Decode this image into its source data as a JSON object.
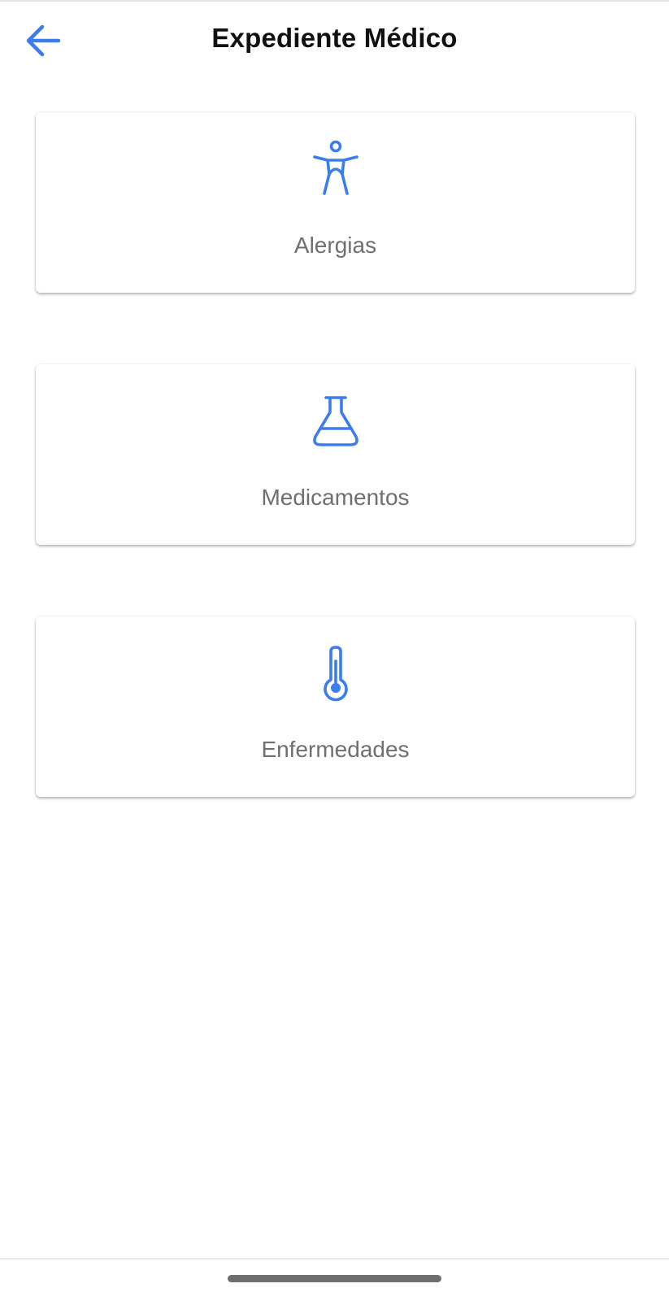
{
  "header": {
    "title": "Expediente Médico",
    "back_icon": "arrow-left-icon"
  },
  "colors": {
    "accent": "#3b7ded",
    "label": "#6f6f6f",
    "title": "#111111"
  },
  "cards": [
    {
      "label": "Alergias",
      "icon": "accessibility-icon"
    },
    {
      "label": "Medicamentos",
      "icon": "flask-icon"
    },
    {
      "label": "Enfermedades",
      "icon": "thermometer-icon"
    }
  ]
}
